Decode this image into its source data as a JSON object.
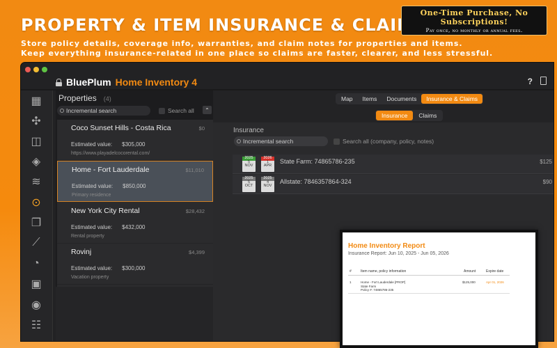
{
  "promo": {
    "title": "PROPERTY & ITEM INSURANCE & CLAIMS",
    "line1": "Store policy details, coverage info, warranties, and claim notes for properties and items.",
    "line2": "Keep everything insurance-related in one place so claims are faster, clearer, and less stressful.",
    "badge_line1": "One-Time Purchase, No Subscriptions!",
    "badge_line2": "Pay once, no monthly or annual fees."
  },
  "app": {
    "brand": "BluePlum",
    "product": "Home Inventory 4",
    "help_label": "?"
  },
  "colors": {
    "accent": "#f28a12",
    "background": "#222224",
    "selected_border": "#d88424"
  },
  "sidebar": {
    "icons": [
      "dashboard-icon",
      "items-icon",
      "rooms-icon",
      "tag-icon",
      "layers-icon",
      "location-icon",
      "copies-icon",
      "chart-icon",
      "pie-icon",
      "photos-icon",
      "user-icon",
      "checklist-icon"
    ],
    "active": "location-icon"
  },
  "properties": {
    "title": "Properties",
    "count": "(4)",
    "search_placeholder": "Incremental search",
    "search_all_label": "Search all",
    "collapse_label": "⌃",
    "items": [
      {
        "name": "Coco Sunset Hills - Costa Rica",
        "value": "$0",
        "est_label": "Estimated value:",
        "est_value": "$305,000",
        "sub": "https://www.playadelcocorental.com/"
      },
      {
        "name": "Home - Fort Lauderdale",
        "value": "$11,010",
        "est_label": "Estimated value:",
        "est_value": "$850,000",
        "sub": "Primary residence"
      },
      {
        "name": "New York City Rental",
        "value": "$28,432",
        "est_label": "Estimated value:",
        "est_value": "$432,000",
        "sub": "Rental property"
      },
      {
        "name": "Rovinj",
        "value": "$4,399",
        "est_label": "Estimated value:",
        "est_value": "$300,000",
        "sub": "Vacation property"
      }
    ]
  },
  "tabs": [
    "Map",
    "Items",
    "Documents",
    "Insurance & Claims"
  ],
  "active_tab": "Insurance & Claims",
  "subtabs": [
    "Insurance",
    "Claims"
  ],
  "active_subtab": "Insurance",
  "insurance": {
    "title": "Insurance",
    "search_placeholder": "Incremental search",
    "search_all_label": "Search all (company, policy, notes)",
    "policies": [
      {
        "name": "State Farm: 74865786-235",
        "amount": "$125",
        "start": {
          "year": "2025",
          "day": "5",
          "month": "NOV"
        },
        "end": {
          "year": "2026",
          "day": "1",
          "month": "APR"
        }
      },
      {
        "name": "Allstate: 7846357864-324",
        "amount": "$90",
        "start": {
          "year": "2025",
          "day": "5",
          "month": "OCT"
        },
        "end": {
          "year": "2025",
          "day": "4",
          "month": "NOV"
        }
      }
    ]
  },
  "report": {
    "title": "Home Inventory Report",
    "subtitle": "Insurance Report:  Jun 10, 2025 - Jun 05, 2026",
    "columns": [
      "#",
      "Item name, policy information",
      "Amount",
      "Expire date"
    ],
    "row": {
      "num": "1",
      "line1": "Home - Fort Lauderdale [PROP]",
      "line2": "State Farm",
      "line3": "Policy #: 74865786-235",
      "amount": "$125,000",
      "expire": "Apr 01, 2026"
    }
  }
}
